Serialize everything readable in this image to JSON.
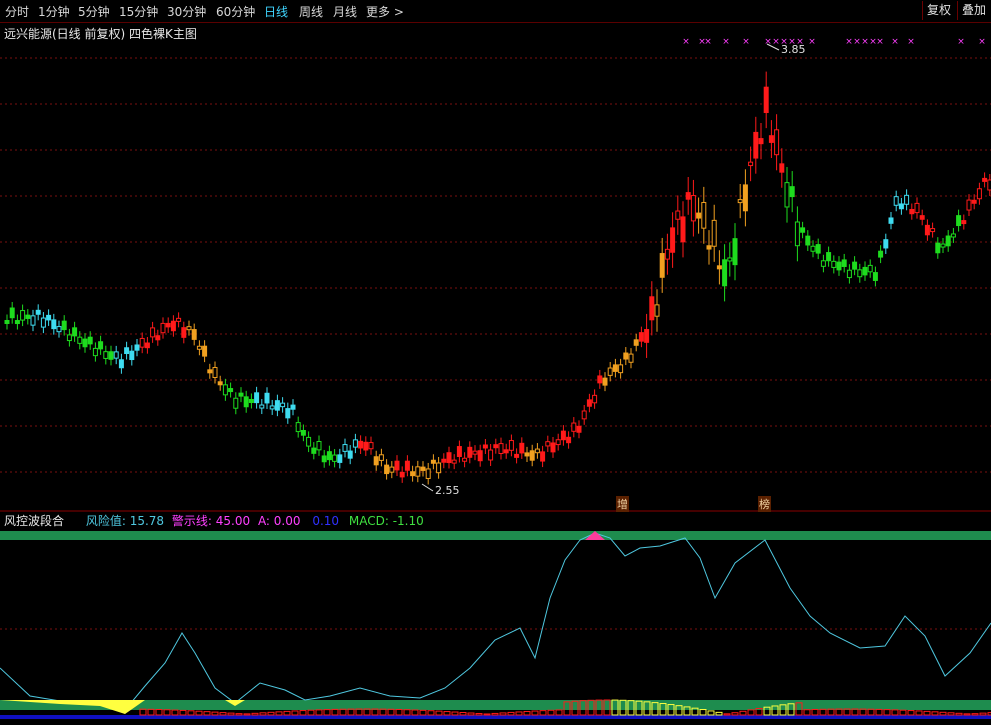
{
  "toolbar": {
    "periods": [
      "分时",
      "1分钟",
      "5分钟",
      "15分钟",
      "30分钟",
      "60分钟",
      "日线",
      "周线",
      "月线",
      "更多"
    ],
    "active": "日线",
    "more_arrow": ">",
    "restore_label": "复权",
    "overlay_label": "叠加"
  },
  "main_title": "远兴能源(日线 前复权) 四色裸K主图",
  "annotations": {
    "high": "3.85",
    "low": "2.55",
    "tag1": "增",
    "tag2": "榜"
  },
  "sub_title": {
    "name": "风控波段合",
    "risk": "风险值: 15.78",
    "warn": "警示线: 45.00",
    "a": "A: 0.00",
    "b": "0.10",
    "macd": "MACD: -1.10"
  },
  "colors": {
    "up_red": "#ff1a1a",
    "down_green": "#1edc1e",
    "cyan": "#3fdcf0",
    "orange": "#f0a020",
    "magenta": "#ff40ff",
    "grid": "#7a1010",
    "band_green": "#1e8c4e",
    "risk_line": "#4fc8e0",
    "yellow": "#ffff40",
    "blue": "#1010c0",
    "pink": "#ff3c9c"
  }
}
